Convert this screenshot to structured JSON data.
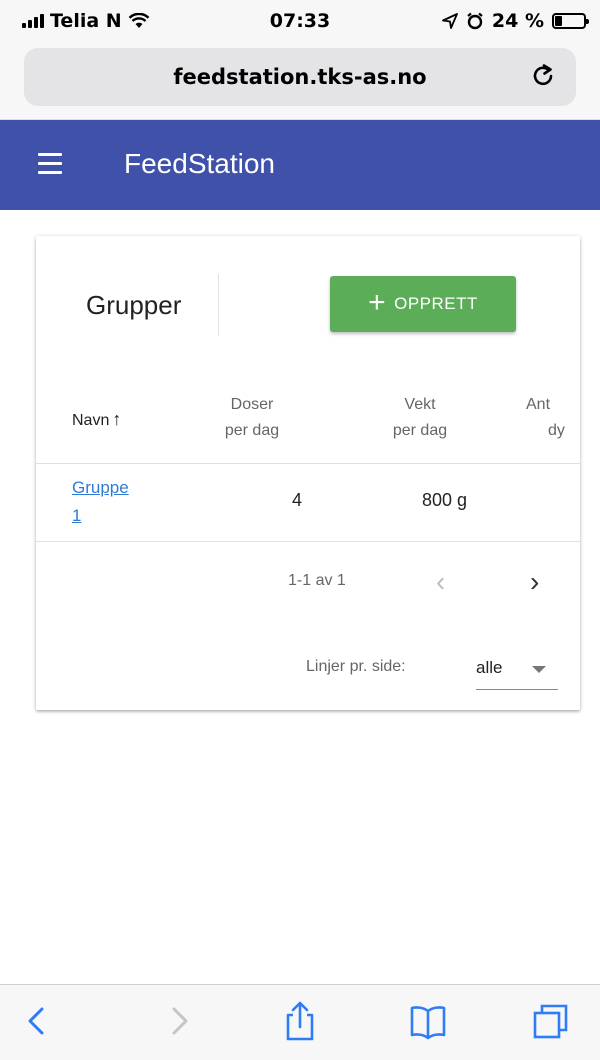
{
  "status_bar": {
    "carrier": "Telia N",
    "time": "07:33",
    "battery_text": "24 %",
    "battery_level": 0.24
  },
  "browser": {
    "url": "feedstation.tks-as.no"
  },
  "app_bar": {
    "title": "FeedStation",
    "color": "#3f51a8"
  },
  "card": {
    "title": "Grupper",
    "create_button": {
      "icon": "plus-icon",
      "label": "OPPRETT",
      "color": "#5cad58"
    },
    "table": {
      "columns": [
        {
          "line1": "Navn",
          "sort_icon": "arrow-up-icon"
        },
        {
          "line1": "Doser",
          "line2": "per dag"
        },
        {
          "line1": "Vekt",
          "line2": "per dag"
        },
        {
          "line1": "Ant",
          "line2": "dy"
        }
      ],
      "rows": [
        {
          "name_line1": "Gruppe",
          "name_line2": "1",
          "doser": "4",
          "vekt": "800 g"
        }
      ]
    },
    "pagination": {
      "range": "1-1 av 1",
      "rows_per_page_label": "Linjer pr. side:",
      "rows_per_page_value": "alle"
    }
  },
  "toolbar": {
    "icons": [
      "back-icon",
      "forward-icon",
      "share-icon",
      "bookmarks-icon",
      "tabs-icon"
    ]
  }
}
